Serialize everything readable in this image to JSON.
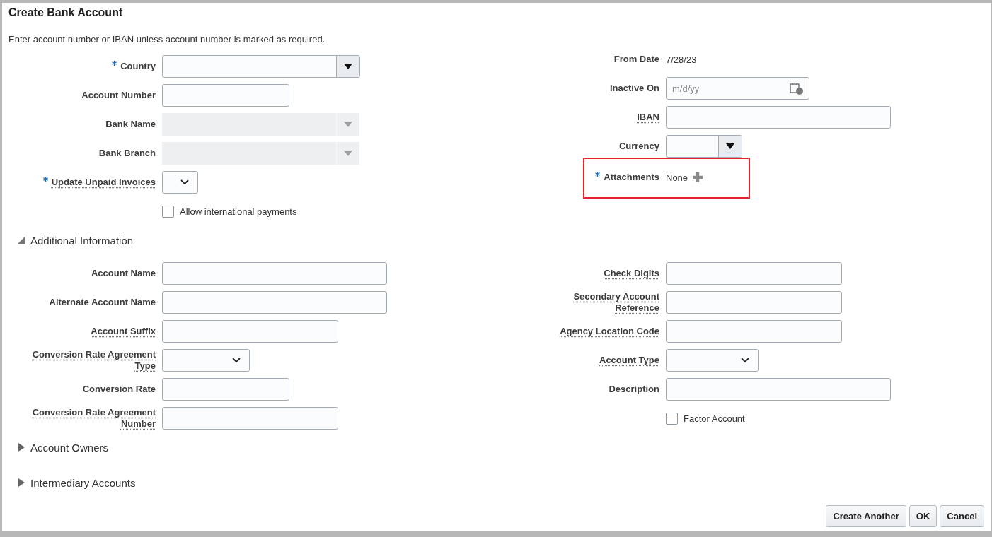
{
  "dialog": {
    "title": "Create Bank Account",
    "instruction": "Enter account number or IBAN unless account number is marked as required."
  },
  "main": {
    "left": [
      {
        "kind": "combo",
        "label": "Country",
        "required": true,
        "help": false,
        "disabled": false
      },
      {
        "kind": "text",
        "label": "Account Number",
        "required": false,
        "help": false
      },
      {
        "kind": "combo",
        "label": "Bank Name",
        "required": false,
        "help": false,
        "disabled": true
      },
      {
        "kind": "combo",
        "label": "Bank Branch",
        "required": false,
        "help": false,
        "disabled": true
      },
      {
        "kind": "choice",
        "label": "Update Unpaid Invoices",
        "required": true,
        "help": true
      },
      {
        "kind": "checkbox",
        "label": "Allow international payments",
        "checked": false
      }
    ],
    "right": [
      {
        "kind": "readonly",
        "label": "From Date",
        "required": false,
        "help": false,
        "value": "7/28/23"
      },
      {
        "kind": "date",
        "label": "Inactive On",
        "required": false,
        "help": false,
        "placeholder": "m/d/yy"
      },
      {
        "kind": "text",
        "label": "IBAN",
        "required": false,
        "help": true
      },
      {
        "kind": "combo",
        "label": "Currency",
        "required": false,
        "help": false,
        "disabled": false
      },
      {
        "kind": "attachments",
        "label": "Attachments",
        "required": true,
        "help": false,
        "value": "None",
        "highlighted": true
      }
    ]
  },
  "sections": [
    {
      "title": "Additional Information",
      "expanded": true,
      "left": [
        {
          "kind": "text",
          "label": "Account Name",
          "required": false,
          "help": false
        },
        {
          "kind": "text",
          "label": "Alternate Account Name",
          "required": false,
          "help": false
        },
        {
          "kind": "text",
          "label": "Account Suffix",
          "required": false,
          "help": true
        },
        {
          "kind": "choice",
          "label": "Conversion Rate Agreement Type",
          "required": false,
          "help": true
        },
        {
          "kind": "text",
          "label": "Conversion Rate",
          "required": false,
          "help": false
        },
        {
          "kind": "text",
          "label": "Conversion Rate Agreement Number",
          "required": false,
          "help": true
        }
      ],
      "right": [
        {
          "kind": "text",
          "label": "Check Digits",
          "required": false,
          "help": true
        },
        {
          "kind": "text",
          "label": "Secondary Account Reference",
          "required": false,
          "help": true
        },
        {
          "kind": "text",
          "label": "Agency Location Code",
          "required": false,
          "help": true
        },
        {
          "kind": "choice",
          "label": "Account Type",
          "required": false,
          "help": true
        },
        {
          "kind": "text",
          "label": "Description",
          "required": false,
          "help": false
        },
        {
          "kind": "checkbox",
          "label": "Factor Account",
          "checked": false
        }
      ]
    },
    {
      "title": "Account Owners",
      "expanded": false
    },
    {
      "title": "Intermediary Accounts",
      "expanded": false
    }
  ],
  "buttons": [
    {
      "label": "Create Another"
    },
    {
      "label": "OK"
    },
    {
      "label": "Cancel"
    }
  ]
}
